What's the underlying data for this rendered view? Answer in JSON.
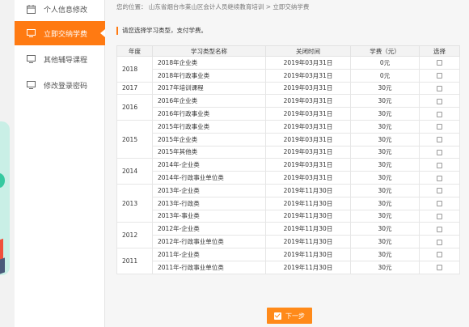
{
  "sidebar": {
    "items": [
      {
        "label": "个人信息修改",
        "icon": "calendar-icon",
        "active": false
      },
      {
        "label": "立即交纳学费",
        "icon": "monitor-icon",
        "active": true
      },
      {
        "label": "其他辅导课程",
        "icon": "monitor-icon",
        "active": false
      },
      {
        "label": "修改登录密码",
        "icon": "monitor-icon",
        "active": false
      }
    ]
  },
  "breadcrumb": "您的位置： 山东省烟台市莱山区会计人员继续教育培训 > 立即交纳学费",
  "tip": "请您选择学习类型，支付学费。",
  "table": {
    "headers": [
      "年度",
      "学习类型名称",
      "关闭时间",
      "学费（元）",
      "选择"
    ],
    "groups": [
      {
        "year": "2018",
        "rows": [
          {
            "name": "2018年企业类",
            "close": "2019年03月31日",
            "fee": "0元"
          },
          {
            "name": "2018年行政事业类",
            "close": "2019年03月31日",
            "fee": "0元"
          }
        ]
      },
      {
        "year": "2017",
        "rows": [
          {
            "name": "2017年培训课程",
            "close": "2019年03月31日",
            "fee": "30元"
          }
        ]
      },
      {
        "year": "2016",
        "rows": [
          {
            "name": "2016年企业类",
            "close": "2019年03月31日",
            "fee": "30元"
          },
          {
            "name": "2016年行政事业类",
            "close": "2019年03月31日",
            "fee": "30元"
          }
        ]
      },
      {
        "year": "2015",
        "rows": [
          {
            "name": "2015年行政事业类",
            "close": "2019年03月31日",
            "fee": "30元"
          },
          {
            "name": "2015年企业类",
            "close": "2019年03月31日",
            "fee": "30元"
          },
          {
            "name": "2015年其他类",
            "close": "2019年03月31日",
            "fee": "30元"
          }
        ]
      },
      {
        "year": "2014",
        "rows": [
          {
            "name": "2014年-企业类",
            "close": "2019年03月31日",
            "fee": "30元"
          },
          {
            "name": "2014年-行政事业单位类",
            "close": "2019年03月31日",
            "fee": "30元"
          }
        ]
      },
      {
        "year": "2013",
        "rows": [
          {
            "name": "2013年-企业类",
            "close": "2019年11月30日",
            "fee": "30元"
          },
          {
            "name": "2013年-行政类",
            "close": "2019年11月30日",
            "fee": "30元"
          },
          {
            "name": "2013年-事业类",
            "close": "2019年11月30日",
            "fee": "30元"
          }
        ]
      },
      {
        "year": "2012",
        "rows": [
          {
            "name": "2012年-企业类",
            "close": "2019年11月30日",
            "fee": "30元"
          },
          {
            "name": "2012年-行政事业单位类",
            "close": "2019年11月30日",
            "fee": "30元"
          }
        ]
      },
      {
        "year": "2011",
        "rows": [
          {
            "name": "2011年-企业类",
            "close": "2019年11月30日",
            "fee": "30元"
          },
          {
            "name": "2011年-行政事业单位类",
            "close": "2019年11月30日",
            "fee": "30元"
          }
        ]
      }
    ]
  },
  "next_button": {
    "label": "下一步",
    "icon": "check-icon"
  },
  "colors": {
    "accent": "#ff7a12",
    "button": "#ff8a1a",
    "header_bg": "#f3f3f3"
  }
}
